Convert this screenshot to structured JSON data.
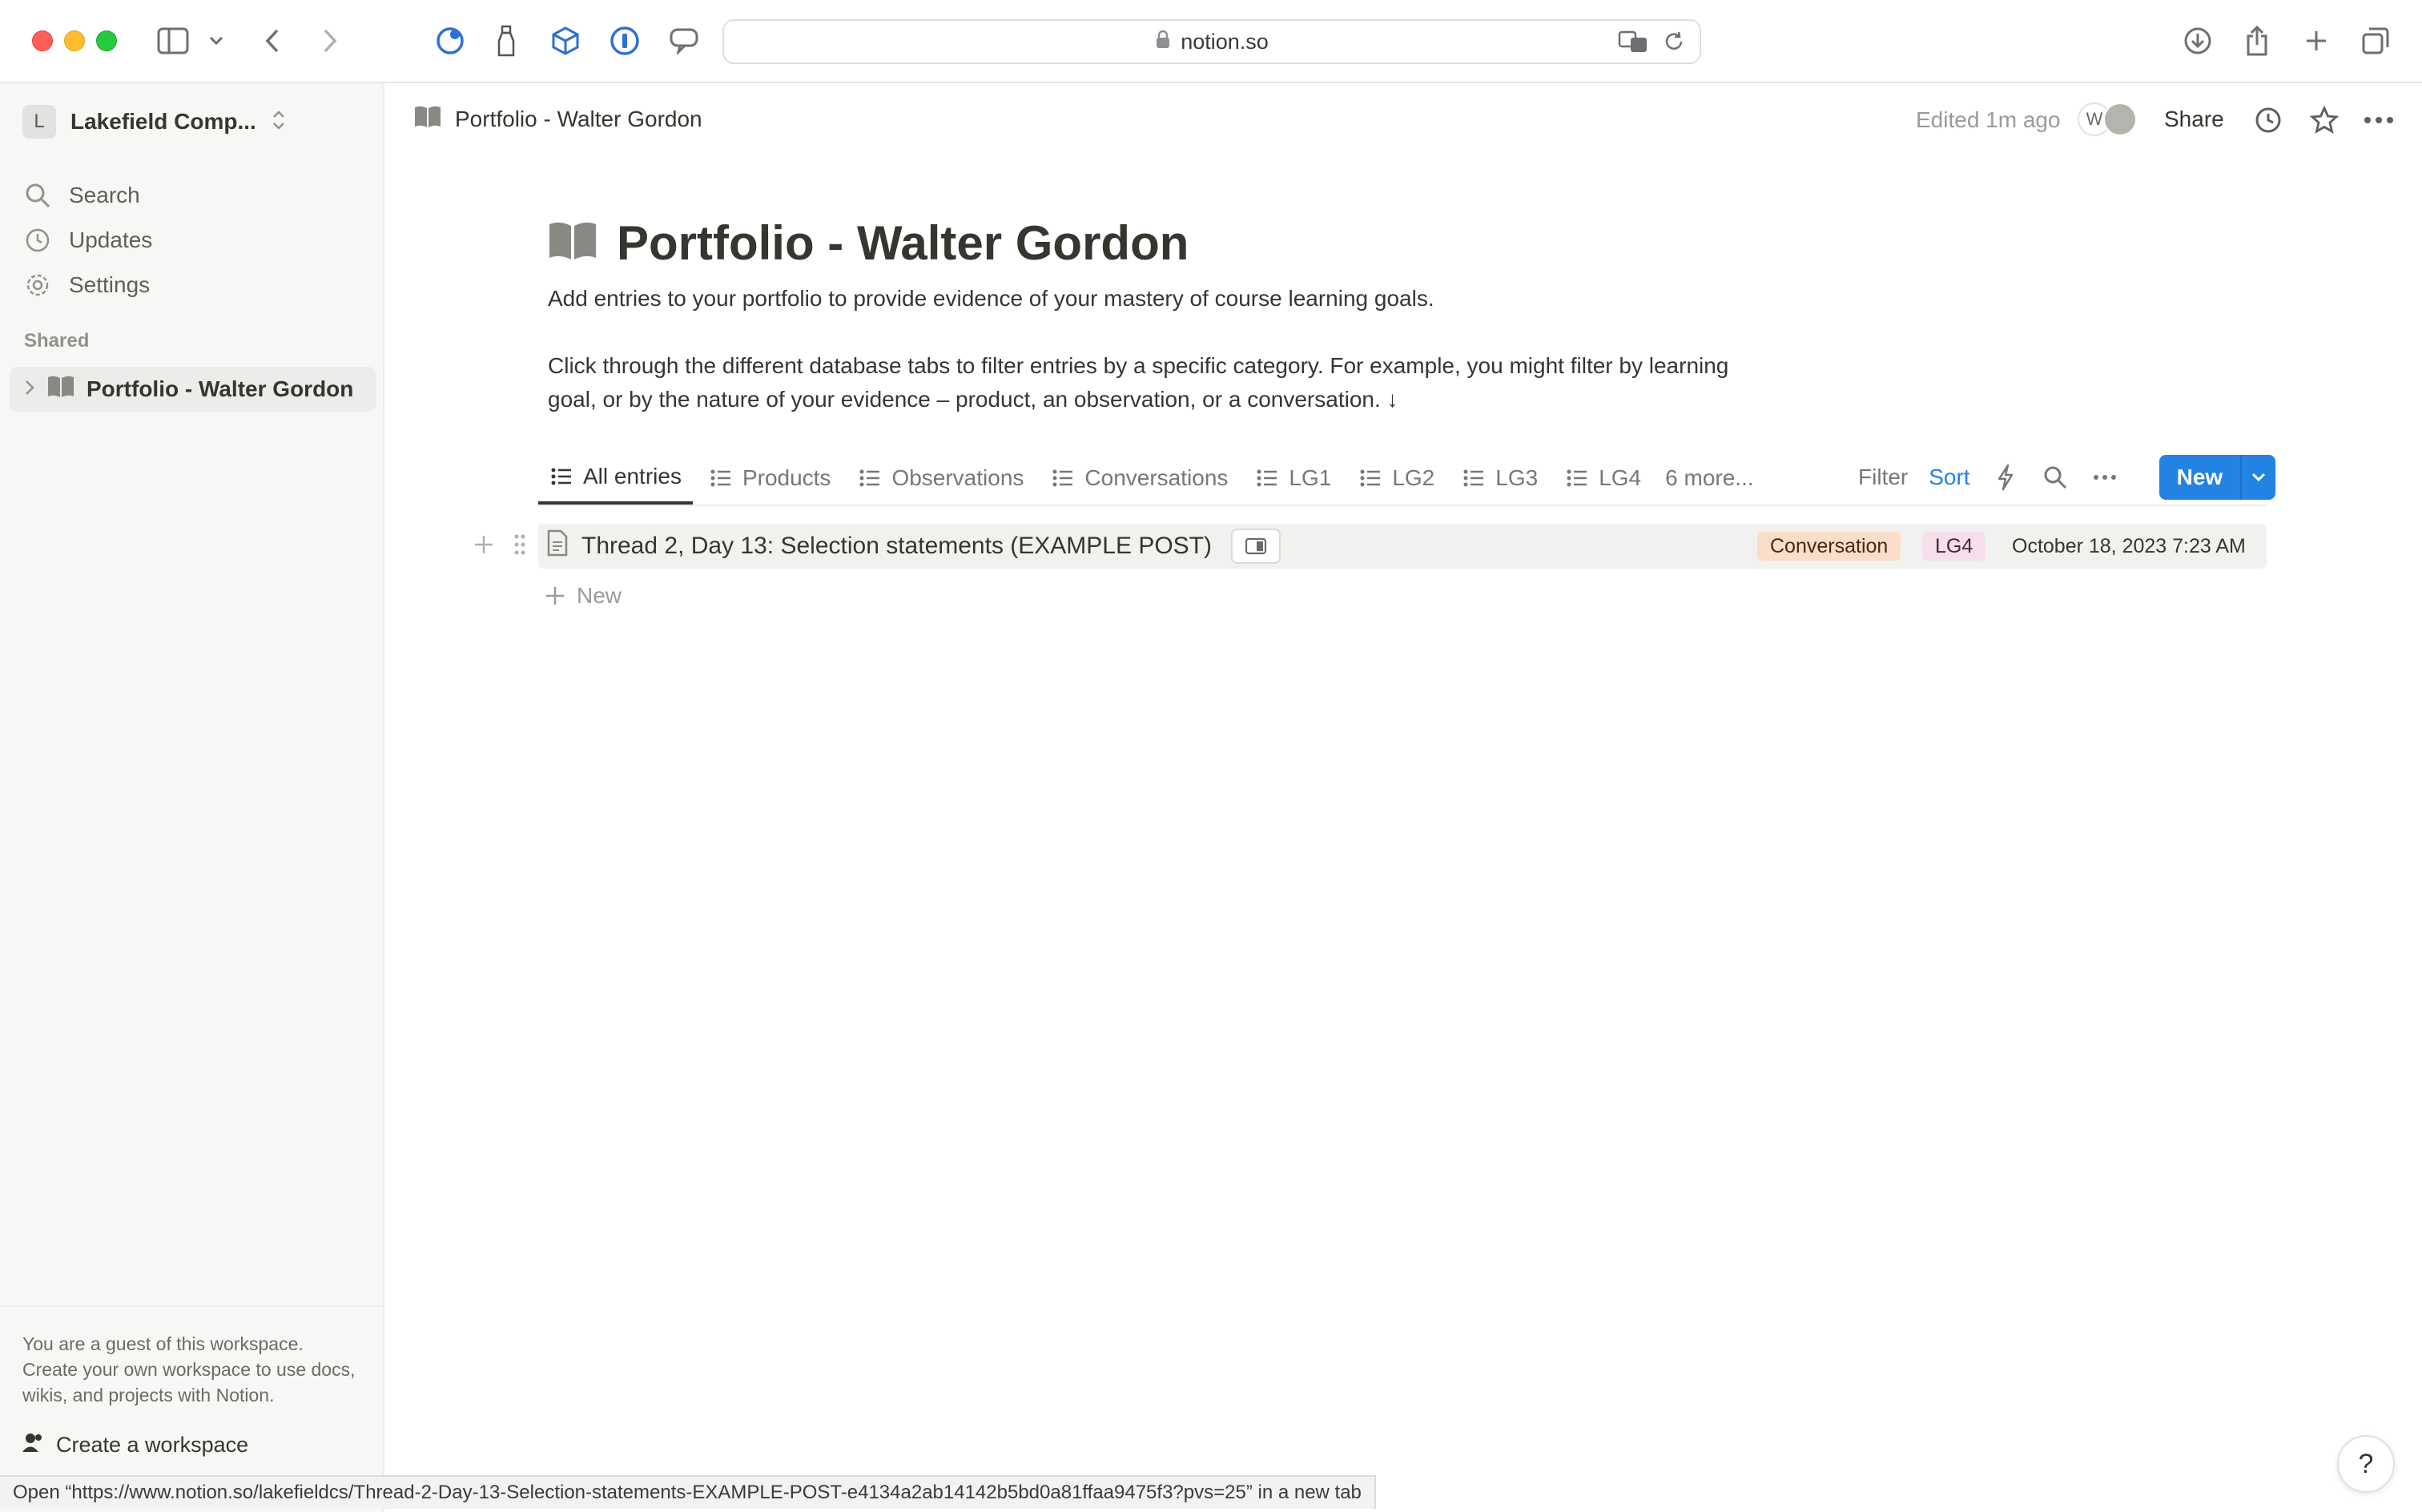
{
  "browser": {
    "url": "notion.so"
  },
  "sidebar": {
    "workspace_initial": "L",
    "workspace_name": "Lakefield Comp...",
    "items": [
      {
        "label": "Search",
        "icon": "search-icon"
      },
      {
        "label": "Updates",
        "icon": "clock-icon"
      },
      {
        "label": "Settings",
        "icon": "gear-icon"
      }
    ],
    "shared_label": "Shared",
    "shared_page": "Portfolio - Walter Gordon",
    "guest_message": "You are a guest of this workspace. Create your own workspace to use docs, wikis, and projects with Notion.",
    "create_workspace": "Create a workspace"
  },
  "topbar": {
    "breadcrumb": "Portfolio - Walter Gordon",
    "edited": "Edited 1m ago",
    "avatar_initial": "W",
    "share_label": "Share"
  },
  "page": {
    "title": "Portfolio - Walter Gordon",
    "description_1": "Add entries to your portfolio to provide evidence of your mastery of course learning goals.",
    "description_2": "Click through the different database tabs to filter entries by a specific category. For example, you might filter by learning goal, or by the nature of your evidence – product, an observation, or a conversation. ↓"
  },
  "database": {
    "tabs": [
      "All entries",
      "Products",
      "Observations",
      "Conversations",
      "LG1",
      "LG2",
      "LG3",
      "LG4"
    ],
    "more_tabs": "6 more...",
    "filter_label": "Filter",
    "sort_label": "Sort",
    "new_label": "New",
    "rows": [
      {
        "title": "Thread 2, Day 13: Selection statements (EXAMPLE POST)",
        "type_tag": "Conversation",
        "goal_tag": "LG4",
        "date": "October 18, 2023 7:23 AM"
      }
    ],
    "add_row_label": "New"
  },
  "statusbar": {
    "text": "Open “https://www.notion.so/lakefieldcs/Thread-2-Day-13-Selection-statements-EXAMPLE-POST-e4134a2ab14142b5bd0a81ffaa9475f3?pvs=25” in a new tab"
  },
  "help_label": "?",
  "colors": {
    "accent": "#2383e2",
    "tag_conversation_bg": "#fadec9",
    "tag_lg4_bg": "#f4dfeb"
  }
}
